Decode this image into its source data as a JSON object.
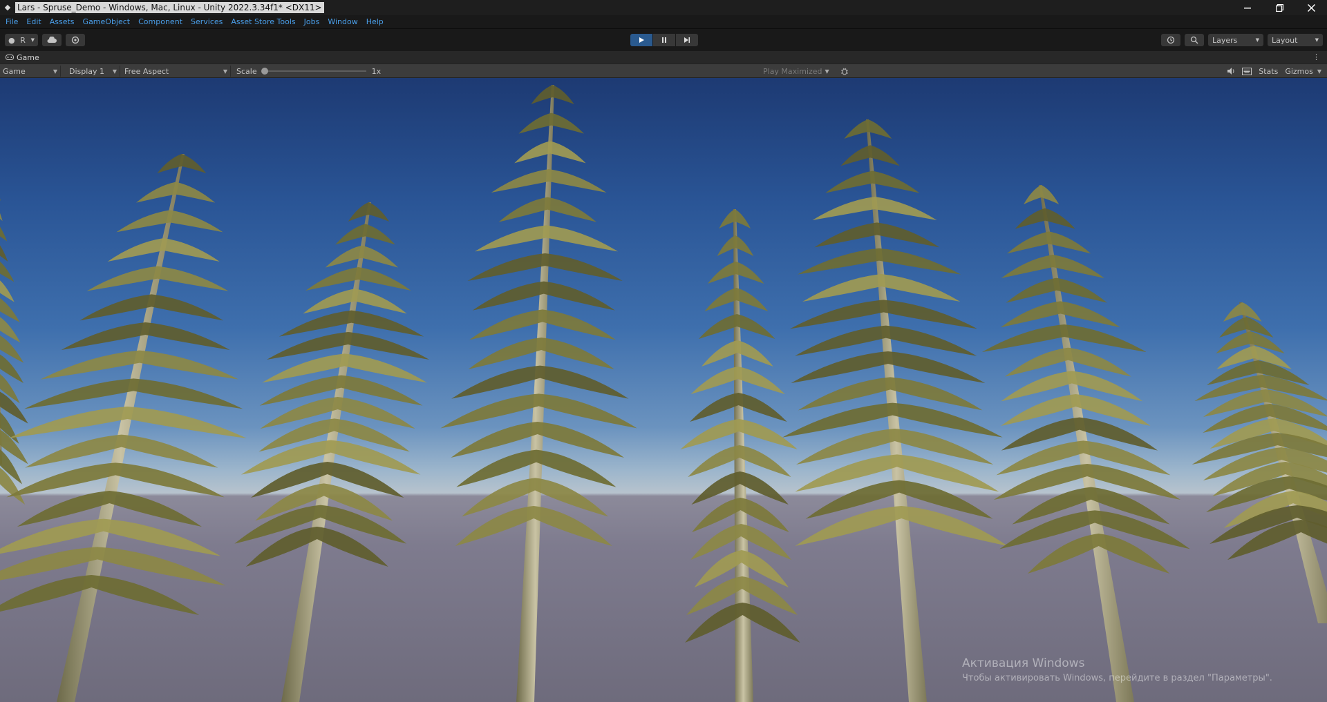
{
  "window": {
    "title": "Lars - Spruse_Demo - Windows, Mac, Linux - Unity 2022.3.34f1* <DX11>",
    "controls": [
      "minimize",
      "restore",
      "close"
    ]
  },
  "menu": {
    "items": [
      "File",
      "Edit",
      "Assets",
      "GameObject",
      "Component",
      "Services",
      "Asset Store Tools",
      "Jobs",
      "Window",
      "Help"
    ]
  },
  "toolbar": {
    "account_label": "R",
    "layers_label": "Layers",
    "layout_label": "Layout",
    "play_state": "playing",
    "accent_color": "#2a5a8f"
  },
  "game_tab": {
    "label": "Game"
  },
  "game_toolbar": {
    "view_mode": "Game",
    "display": "Display 1",
    "aspect": "Free Aspect",
    "scale_label": "Scale",
    "scale_value": "1x",
    "play_maximized": "Play Maximized",
    "stats_label": "Stats",
    "gizmos_label": "Gizmos"
  },
  "viewport": {
    "scene": "spruce trees against blue sky",
    "watermark_title": "Активация Windows",
    "watermark_text": "Чтобы активировать Windows, перейдите в раздел \"Параметры\"."
  }
}
